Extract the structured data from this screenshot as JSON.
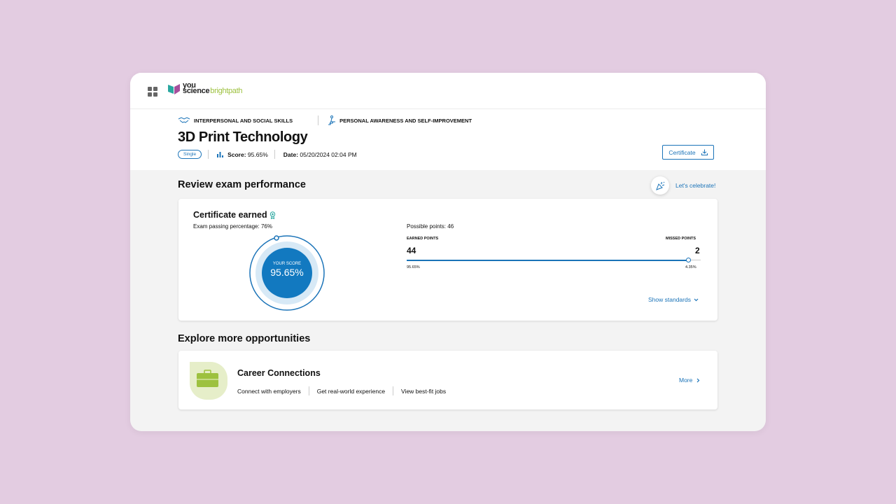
{
  "app": {
    "logo_line1": "you",
    "logo_line2": "science",
    "logo_suffix": "brightpath"
  },
  "header": {
    "categories": [
      {
        "label": "INTERPERSONAL AND SOCIAL SKILLS",
        "icon": "handshake-icon"
      },
      {
        "label": "PERSONAL AWARENESS AND SELF-IMPROVEMENT",
        "icon": "person-stairs-icon"
      }
    ],
    "title": "3D Print Technology",
    "badge": "Single",
    "score_label": "Score:",
    "score_value": "95.65%",
    "date_label": "Date:",
    "date_value": "05/20/2024 02:04 PM",
    "certificate_button": "Certificate"
  },
  "review": {
    "section_title": "Review exam performance",
    "celebrate_link": "Let's celebrate!",
    "card_title": "Certificate earned",
    "passing_text": "Exam passing percentage: 76%",
    "donut_label": "YOUR SCORE",
    "donut_value": "95.65%",
    "score_fraction": 0.9565,
    "possible_points": "Possible points: 46",
    "earned_label": "EARNED POINTS",
    "earned_value": "44",
    "earned_pct": "95.65%",
    "missed_label": "MISSED POINTS",
    "missed_value": "2",
    "missed_pct": "4.35%",
    "show_standards": "Show standards"
  },
  "explore": {
    "section_title": "Explore more opportunities",
    "card_title": "Career Connections",
    "links": [
      "Connect with employers",
      "Get real-world experience",
      "View best-fit jobs"
    ],
    "more_link": "More"
  },
  "colors": {
    "accent": "#1a73b8",
    "brand_green": "#9dc13f",
    "background": "#e3cce1"
  }
}
